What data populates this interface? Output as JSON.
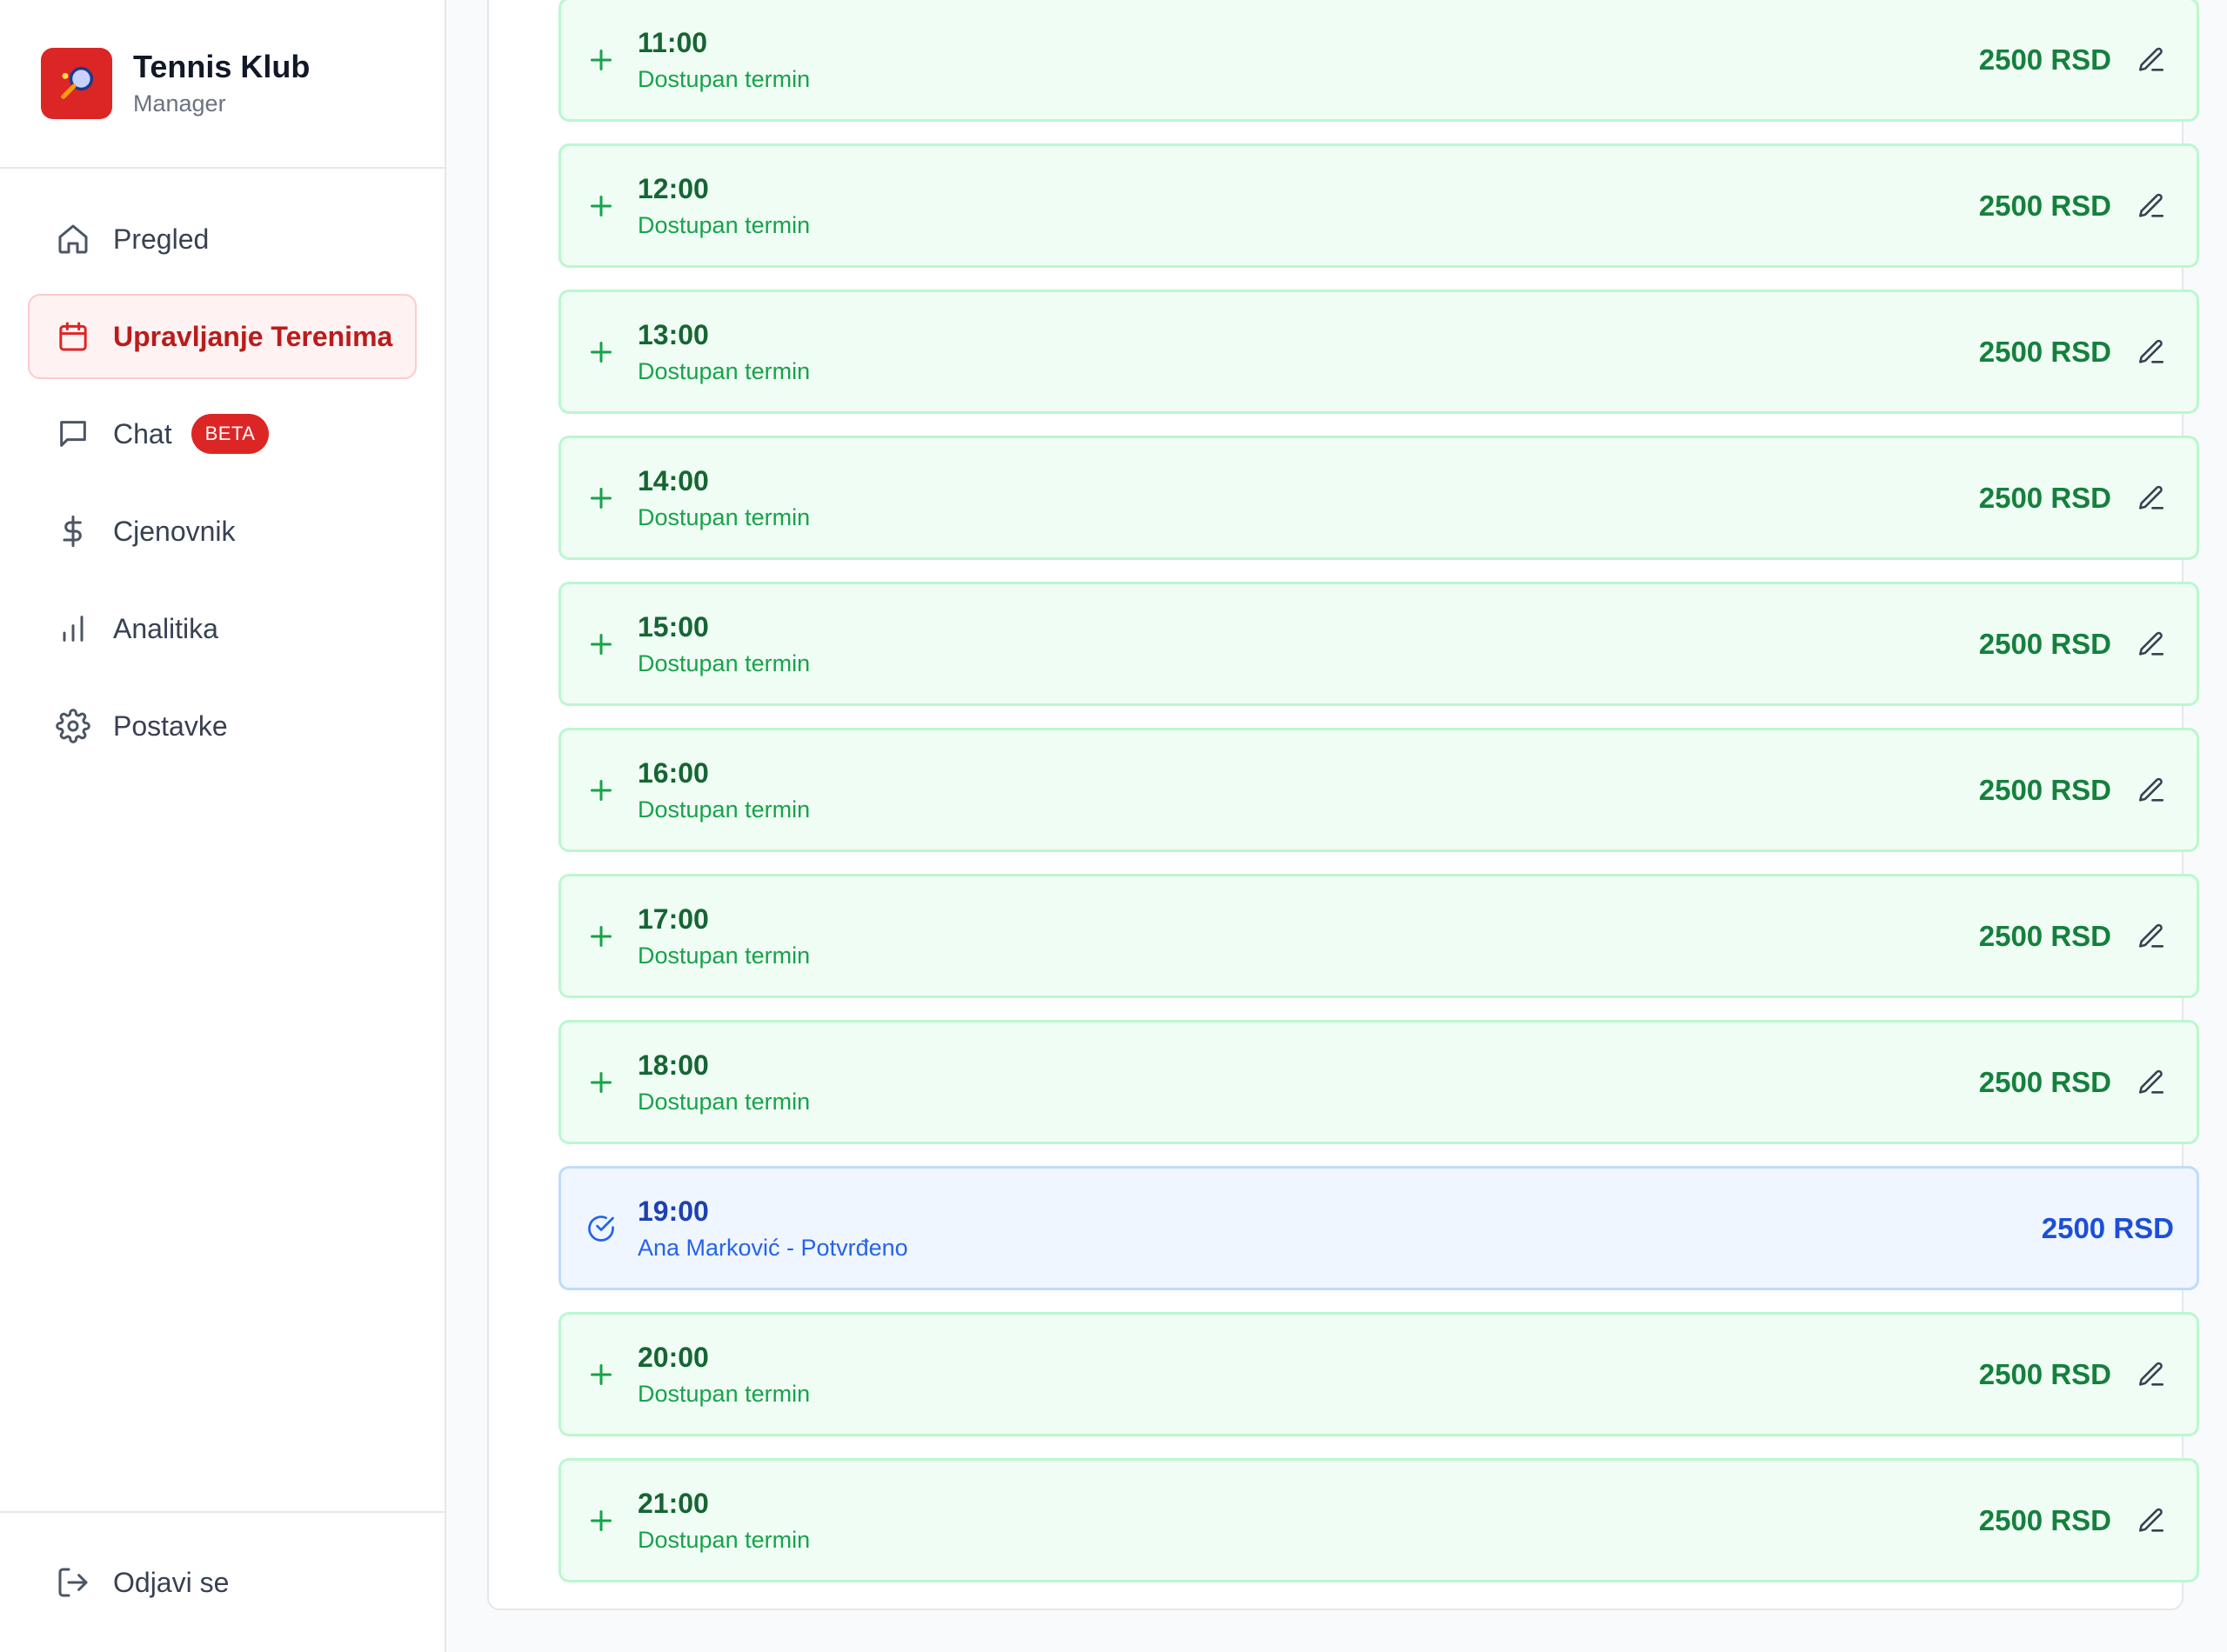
{
  "brand": {
    "title": "Tennis Klub",
    "subtitle": "Manager"
  },
  "sidebar": {
    "items": [
      {
        "label": "Pregled",
        "icon": "home-icon",
        "active": false
      },
      {
        "label": "Upravljanje Terenima",
        "icon": "calendar-icon",
        "active": true
      },
      {
        "label": "Chat",
        "icon": "chat-icon",
        "active": false,
        "badge": "BETA"
      },
      {
        "label": "Cjenovnik",
        "icon": "dollar-icon",
        "active": false
      },
      {
        "label": "Analitika",
        "icon": "bar-chart-icon",
        "active": false
      },
      {
        "label": "Postavke",
        "icon": "gear-icon",
        "active": false
      }
    ],
    "logout_label": "Odjavi se"
  },
  "slots": [
    {
      "time": "11:00",
      "status": "Dostupan termin",
      "price": "2500 RSD",
      "state": "available"
    },
    {
      "time": "12:00",
      "status": "Dostupan termin",
      "price": "2500 RSD",
      "state": "available"
    },
    {
      "time": "13:00",
      "status": "Dostupan termin",
      "price": "2500 RSD",
      "state": "available"
    },
    {
      "time": "14:00",
      "status": "Dostupan termin",
      "price": "2500 RSD",
      "state": "available"
    },
    {
      "time": "15:00",
      "status": "Dostupan termin",
      "price": "2500 RSD",
      "state": "available"
    },
    {
      "time": "16:00",
      "status": "Dostupan termin",
      "price": "2500 RSD",
      "state": "available"
    },
    {
      "time": "17:00",
      "status": "Dostupan termin",
      "price": "2500 RSD",
      "state": "available"
    },
    {
      "time": "18:00",
      "status": "Dostupan termin",
      "price": "2500 RSD",
      "state": "available"
    },
    {
      "time": "19:00",
      "status": "Ana Marković - Potvrđeno",
      "price": "2500 RSD",
      "state": "booked"
    },
    {
      "time": "20:00",
      "status": "Dostupan termin",
      "price": "2500 RSD",
      "state": "available"
    },
    {
      "time": "21:00",
      "status": "Dostupan termin",
      "price": "2500 RSD",
      "state": "available"
    }
  ],
  "colors": {
    "brand_red": "#dc2626",
    "available_bg": "#f0fdf4",
    "available_border": "#bbf7d0",
    "available_text": "#15803d",
    "booked_bg": "#eff6ff",
    "booked_border": "#bfdbfe",
    "booked_text": "#1d4ed8"
  }
}
